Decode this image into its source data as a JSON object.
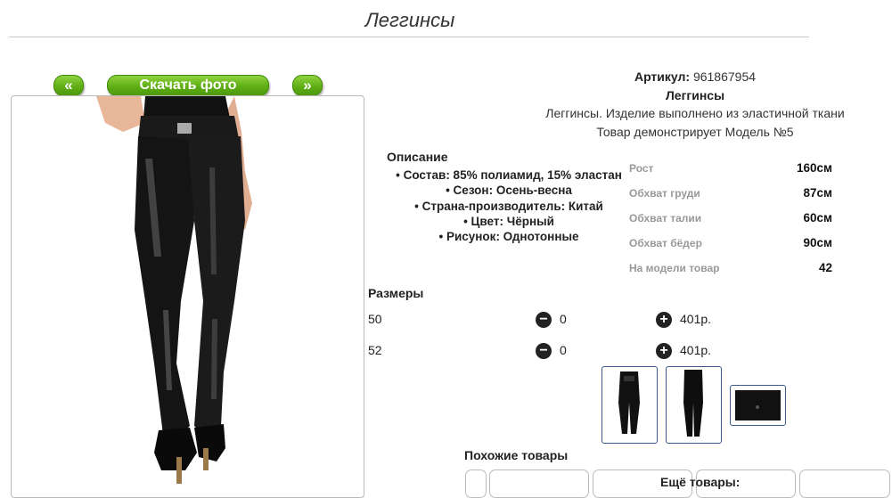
{
  "page": {
    "title": "Леггинсы"
  },
  "gallery": {
    "prev_label": "«",
    "download_label": "Скачать фото",
    "next_label": "»",
    "main_photo_icon": "model-in-black-leggings-image"
  },
  "product": {
    "article_label": "Артикул:",
    "article_value": "961867954",
    "name": "Леггинсы",
    "short_description": "Леггинсы. Изделие выполнено из эластичной ткани",
    "model_note": "Товар демонстрирует Модель №5"
  },
  "description": {
    "title": "Описание",
    "items": [
      "• Состав: 85% полиамид, 15% эластан",
      "• Сезон: Осень-весна",
      "• Страна-производитель: Китай",
      "• Цвет: Чёрный",
      "• Рисунок: Однотонные"
    ]
  },
  "model_measurements": [
    {
      "label": "Рост",
      "value": "160см"
    },
    {
      "label": "Обхват груди",
      "value": "87см"
    },
    {
      "label": "Обхват талии",
      "value": "60см"
    },
    {
      "label": "Обхват бёдер",
      "value": "90см"
    },
    {
      "label": "На модели товар",
      "value": "42"
    }
  ],
  "sizes": {
    "title": "Размеры",
    "rows": [
      {
        "size": "50",
        "minus_icon": "minus-circle-icon",
        "qty": "0",
        "plus_icon": "plus-circle-icon",
        "price": "401р."
      },
      {
        "size": "52",
        "minus_icon": "minus-circle-icon",
        "qty": "0",
        "plus_icon": "plus-circle-icon",
        "price": "401р."
      }
    ]
  },
  "thumbnails": [
    "thumb-front-view",
    "thumb-back-view",
    "thumb-fabric-detail"
  ],
  "similar": {
    "title": "Похожие товары"
  },
  "more": {
    "title": "Ещё товары:"
  },
  "colors": {
    "button_green": "#5fae15",
    "thumb_border": "#3a5a8a",
    "text": "#222222"
  }
}
